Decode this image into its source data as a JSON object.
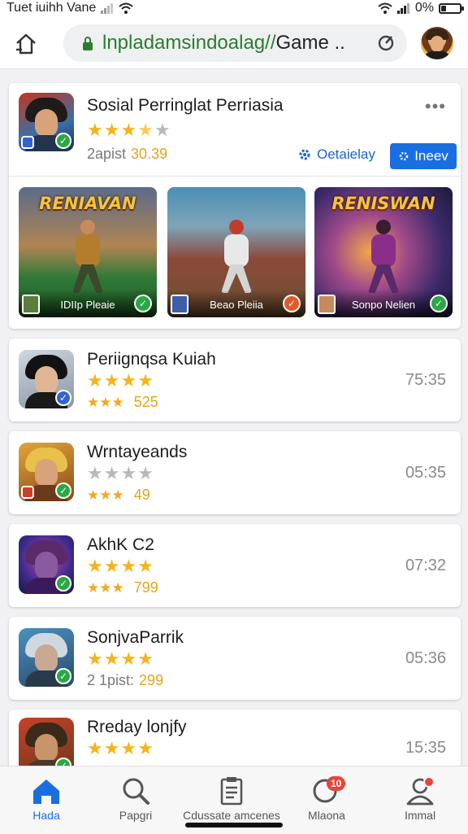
{
  "status": {
    "carrier": "Tuet iuihh Vane",
    "battery": "0%",
    "battery_level": 0.25
  },
  "browser": {
    "url_domain": "lnpladamsindoalag//",
    "url_rest": "Game ...",
    "icons": {
      "home": "home-icon",
      "lock": "lock-icon",
      "reload": "reload-icon"
    }
  },
  "featured": {
    "title": "Sosial Perringlat Perriasia",
    "rating": 3.5,
    "meta_label": "2apist",
    "meta_value": "30.39",
    "link_label": "Oetaielay",
    "button_label": "Ineev",
    "screenshots": [
      {
        "banner": "RENIAVAN",
        "caption": "IDIIp Pleaie"
      },
      {
        "banner": "",
        "caption": "Beao Pleiia"
      },
      {
        "banner": "RENISWAN",
        "caption": "Sonpo Nelien"
      }
    ]
  },
  "apps": [
    {
      "name": "Periignqsa Kuiah",
      "stars": 4,
      "meta": "525",
      "meta_stars": 3,
      "meta_prefix": "",
      "time": "75:35"
    },
    {
      "name": "Wrntayeands",
      "stars": 0,
      "meta": "49",
      "meta_stars": 3,
      "meta_prefix": "",
      "time": "05:35"
    },
    {
      "name": "AkhK C2",
      "stars": 4,
      "meta": "799",
      "meta_stars": 3,
      "meta_prefix": "",
      "time": "07:32"
    },
    {
      "name": "SonjvaParrik",
      "stars": 4,
      "meta": "299",
      "meta_stars": 0,
      "meta_prefix": "2 1pist:",
      "time": "05:36"
    },
    {
      "name": "Rreday lonjfy",
      "stars": 4,
      "meta": "",
      "meta_stars": 0,
      "meta_prefix": "",
      "time": "15:35"
    }
  ],
  "nav": [
    {
      "label": "Hada",
      "icon": "home-icon",
      "active": true
    },
    {
      "label": "Papgri",
      "icon": "search-icon",
      "active": false
    },
    {
      "label": "Cdussate amcenes",
      "icon": "clipboard-icon",
      "active": false
    },
    {
      "label": "Mlaona",
      "icon": "chat-icon",
      "active": false,
      "badge": "10"
    },
    {
      "label": "Immal",
      "icon": "profile-icon",
      "active": false
    }
  ],
  "colors": {
    "accent": "#1a6fe0",
    "star": "#f5b41b",
    "url_green": "#2a7d2c",
    "verify": "#2aa845"
  }
}
